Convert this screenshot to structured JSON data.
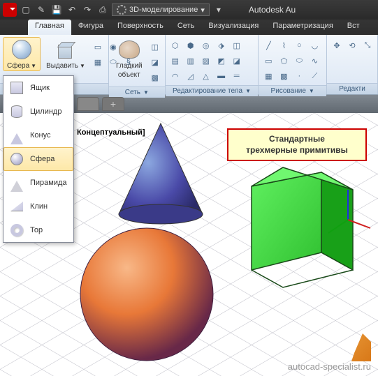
{
  "titlebar": {
    "workspace": "3D-моделирование",
    "app_title": "Autodesk Au"
  },
  "ribbon_tabs": [
    "Главная",
    "Фигура",
    "Поверхность",
    "Сеть",
    "Визуализация",
    "Параметризация",
    "Вст"
  ],
  "ribbon": {
    "panel1": {
      "btn_sphere": "Сфера",
      "btn_extrude": "Выдавить",
      "title": "ие"
    },
    "panel2": {
      "btn_smooth_l1": "Гладкий",
      "btn_smooth_l2": "объект",
      "title": "Сеть"
    },
    "panel3": {
      "title": "Редактирование тела"
    },
    "panel4": {
      "title": "Рисование"
    },
    "panel5": {
      "title": "Редакти"
    }
  },
  "dropdown": {
    "items": [
      {
        "label": "Ящик",
        "icon": "box"
      },
      {
        "label": "Цилиндр",
        "icon": "cyl"
      },
      {
        "label": "Конус",
        "icon": "cone"
      },
      {
        "label": "Сфера",
        "icon": "sphere"
      },
      {
        "label": "Пирамида",
        "icon": "pyr"
      },
      {
        "label": "Клин",
        "icon": "wedge"
      },
      {
        "label": "Тор",
        "icon": "torus"
      }
    ]
  },
  "viewport": {
    "style_label": "Концептуальный]",
    "callout_l1": "Стандартные",
    "callout_l2": "трехмерные примитивы",
    "watermark": "autocad-specialist.ru"
  }
}
